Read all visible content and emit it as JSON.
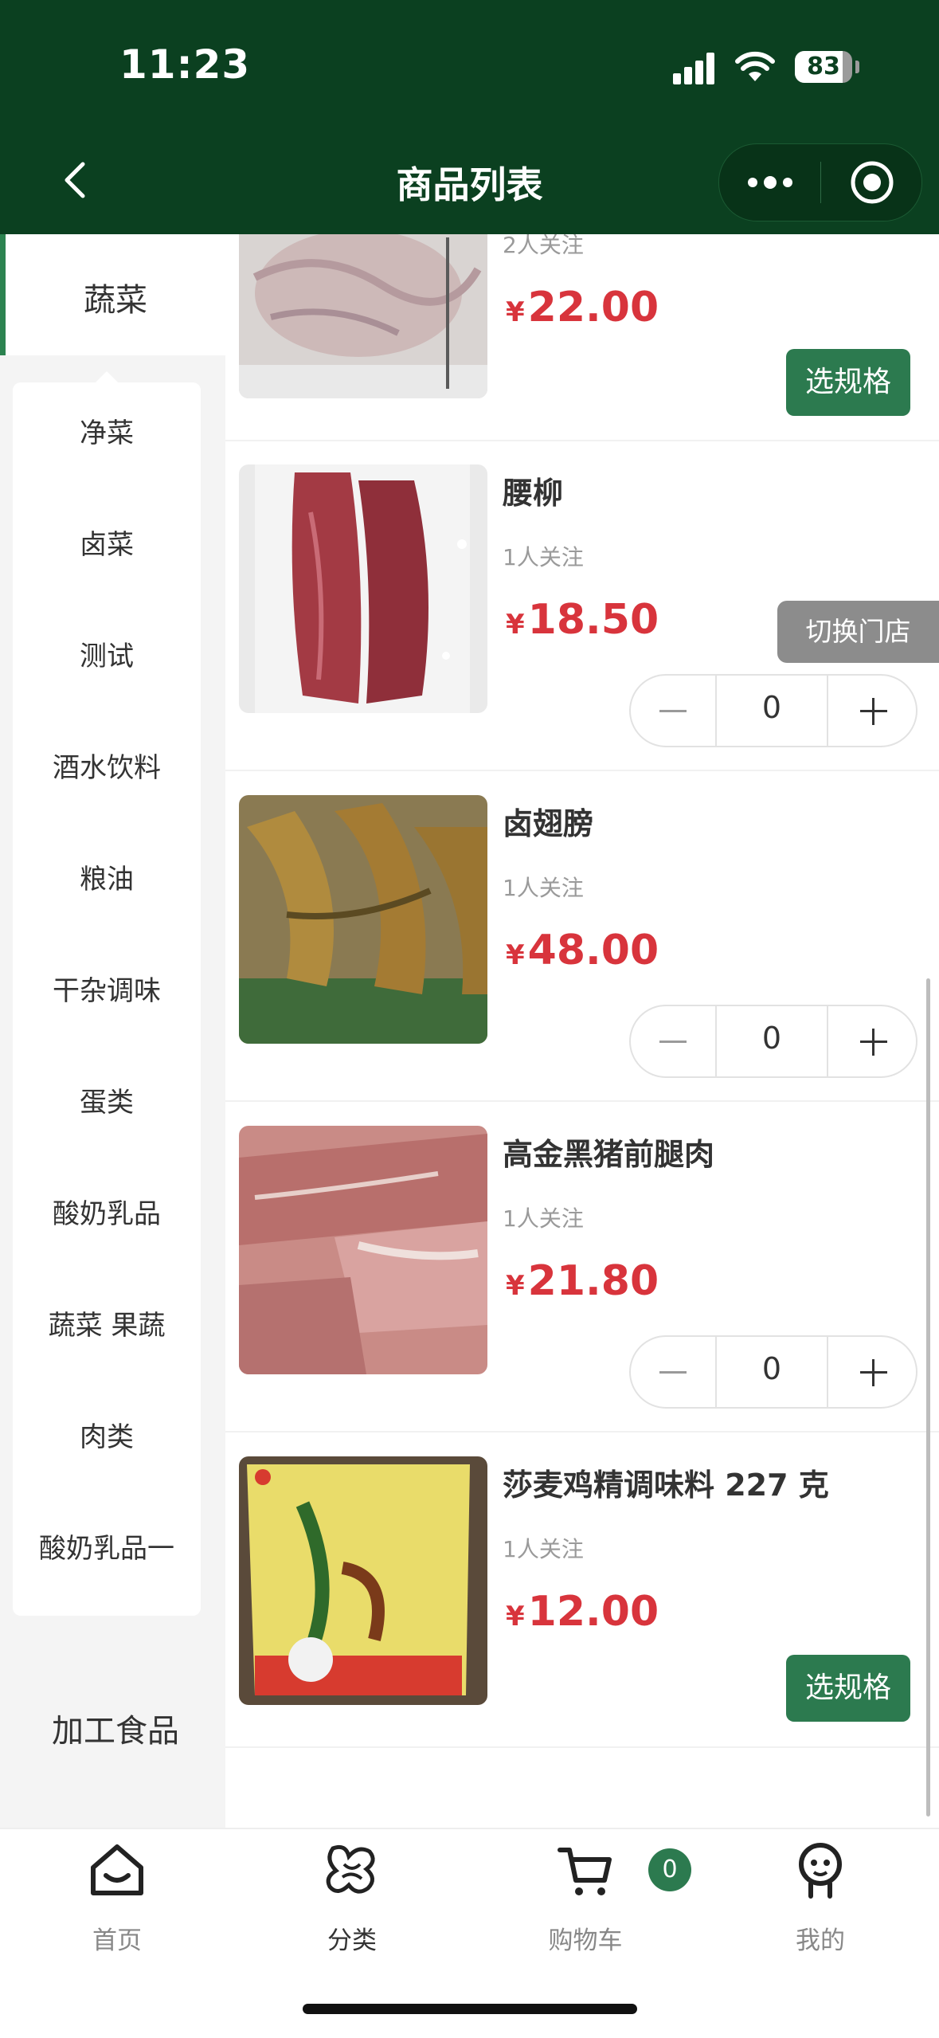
{
  "status_bar": {
    "time": "11:23",
    "battery": "83",
    "battery_level": 0.83
  },
  "header": {
    "title": "商品列表"
  },
  "sidebar": {
    "active_category": "蔬菜",
    "subcategories": [
      "净菜",
      "卤菜",
      "测试",
      "酒水饮料",
      "粮油",
      "干杂调味",
      "蛋类",
      "酸奶乳品",
      "蔬菜 果蔬",
      "肉类",
      "酸奶乳品一"
    ],
    "next_category": "加工食品"
  },
  "products": [
    {
      "name": "",
      "follow": "2人关注",
      "yen": "¥",
      "price": "22.00",
      "action": "选规格"
    },
    {
      "name": "腰柳",
      "follow": "1人关注",
      "yen": "¥",
      "price": "18.50",
      "qty": "0"
    },
    {
      "name": "卤翅膀",
      "follow": "1人关注",
      "yen": "¥",
      "price": "48.00",
      "qty": "0"
    },
    {
      "name": "高金黑猪前腿肉",
      "follow": "1人关注",
      "yen": "¥",
      "price": "21.80",
      "qty": "0"
    },
    {
      "name": "莎麦鸡精调味料 227 克",
      "follow": "1人关注",
      "yen": "¥",
      "price": "12.00",
      "action": "选规格"
    }
  ],
  "floating": {
    "switch_store": "切换门店"
  },
  "tabbar": {
    "items": [
      {
        "label": "首页",
        "icon": "home-icon"
      },
      {
        "label": "分类",
        "icon": "category-icon"
      },
      {
        "label": "购物车",
        "icon": "cart-icon"
      },
      {
        "label": "我的",
        "icon": "profile-icon"
      }
    ],
    "cart_count": "0"
  },
  "colors": {
    "header_bg": "#0b4020",
    "accent": "#2c7a4f",
    "price": "#d8343c"
  }
}
